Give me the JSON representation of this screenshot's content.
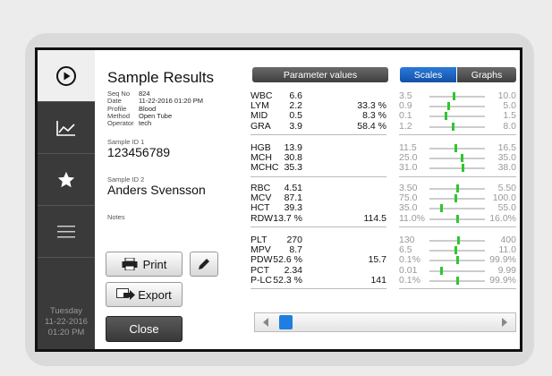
{
  "sidebar": {
    "items": [
      {
        "icon": "play-icon"
      },
      {
        "icon": "chart-icon"
      },
      {
        "icon": "star-icon"
      },
      {
        "icon": "menu-icon"
      }
    ],
    "day": "Tuesday",
    "date": "11-22-2016",
    "time": "01:20 PM"
  },
  "sample": {
    "title": "Sample Results",
    "meta": [
      {
        "key": "Seq No",
        "value": "824"
      },
      {
        "key": "Date",
        "value": "11-22-2016 01:20 PM"
      },
      {
        "key": "Profile",
        "value": "Blood"
      },
      {
        "key": "Method",
        "value": "Open Tube"
      },
      {
        "key": "Operator",
        "value": "tech"
      }
    ],
    "id1_label": "Sample ID 1",
    "id1": "123456789",
    "id2_label": "Sample ID 2",
    "id2": "Anders Svensson",
    "notes_label": "Notes"
  },
  "buttons": {
    "print": "Print",
    "export": "Export",
    "close": "Close"
  },
  "tabs": {
    "parameters": "Parameter values",
    "scales": "Scales",
    "graphs": "Graphs"
  },
  "colors": {
    "accent": "#1565c0",
    "marker": "#2fc62f",
    "header_dark": "#444444"
  },
  "groups": [
    {
      "rows": [
        {
          "name": "WBC",
          "value": "6.6",
          "extra": "",
          "low": "3.5",
          "high": "10.0",
          "level": 0.45
        },
        {
          "name": "LYM",
          "value": "2.2",
          "extra": "33.3 %",
          "low": "0.9",
          "high": "5.0",
          "level": 0.35
        },
        {
          "name": "MID",
          "value": "0.5",
          "extra": "8.3 %",
          "low": "0.1",
          "high": "1.5",
          "level": 0.3
        },
        {
          "name": "GRA",
          "value": "3.9",
          "extra": "58.4 %",
          "low": "1.2",
          "high": "8.0",
          "level": 0.42
        }
      ]
    },
    {
      "rows": [
        {
          "name": "HGB",
          "value": "13.9",
          "extra": "",
          "low": "11.5",
          "high": "16.5",
          "level": 0.48
        },
        {
          "name": "MCH",
          "value": "30.8",
          "extra": "",
          "low": "25.0",
          "high": "35.0",
          "level": 0.58
        },
        {
          "name": "MCHC",
          "value": "35.3",
          "extra": "",
          "low": "31.0",
          "high": "38.0",
          "level": 0.6
        }
      ]
    },
    {
      "rows": [
        {
          "name": "RBC",
          "value": "4.51",
          "extra": "",
          "low": "3.50",
          "high": "5.50",
          "level": 0.5
        },
        {
          "name": "MCV",
          "value": "87.1",
          "extra": "",
          "low": "75.0",
          "high": "100.0",
          "level": 0.48
        },
        {
          "name": "HCT",
          "value": "39.3",
          "extra": "",
          "low": "35.0",
          "high": "55.0",
          "level": 0.22
        },
        {
          "name": "RDW",
          "value": "13.7 %",
          "extra": "114.5",
          "low": "11.0%",
          "high": "16.0%",
          "level": 0.5
        }
      ]
    },
    {
      "rows": [
        {
          "name": "PLT",
          "value": "270",
          "extra": "",
          "low": "130",
          "high": "400",
          "level": 0.52
        },
        {
          "name": "MPV",
          "value": "8.7",
          "extra": "",
          "low": "6.5",
          "high": "11.0",
          "level": 0.48
        },
        {
          "name": "PDW",
          "value": "52.6 %",
          "extra": "15.7",
          "low": "0.1%",
          "high": "99.9%",
          "level": 0.5
        },
        {
          "name": "PCT",
          "value": "2.34",
          "extra": "",
          "low": "0.01",
          "high": "9.99",
          "level": 0.22
        },
        {
          "name": "P-LC",
          "value": "52.3 %",
          "extra": "141",
          "low": "0.1%",
          "high": "99.9%",
          "level": 0.5
        }
      ]
    }
  ]
}
